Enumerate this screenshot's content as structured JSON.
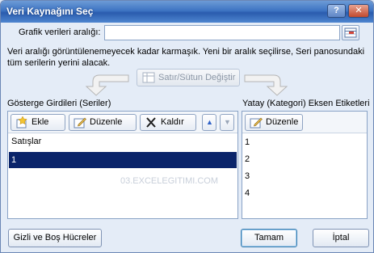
{
  "window": {
    "title": "Veri Kaynağını Seç",
    "help_label": "?",
    "close_label": "✕"
  },
  "range": {
    "label": "Grafik verileri aralığı:",
    "value": ""
  },
  "info_text": "Veri aralığı görüntülenemeyecek kadar karmaşık. Yeni bir aralık seçilirse, Seri panosundaki tüm serilerin yerini alacak.",
  "swap_button": {
    "label": "Satır/Sütun Değiştir",
    "enabled": false
  },
  "series_panel": {
    "title": "Gösterge Girdileri (Seriler)",
    "add_label": "Ekle",
    "edit_label": "Düzenle",
    "remove_label": "Kaldır",
    "up_label": "▲",
    "down_label": "▼",
    "items": [
      {
        "label": "Satışlar",
        "selected": false
      },
      {
        "label": "1",
        "selected": true
      }
    ]
  },
  "category_panel": {
    "title": "Yatay (Kategori) Eksen Etiketleri",
    "edit_label": "Düzenle",
    "items": [
      "1",
      "2",
      "3",
      "4"
    ]
  },
  "watermark": "03.EXCELEGITIMI.COM",
  "buttons": {
    "hidden_cells": "Gizli ve Boş Hücreler",
    "ok": "Tamam",
    "cancel": "İptal"
  },
  "colors": {
    "selection": "#0a246a",
    "title_bar": "#3d74c3",
    "close_button": "#c24a2e"
  }
}
